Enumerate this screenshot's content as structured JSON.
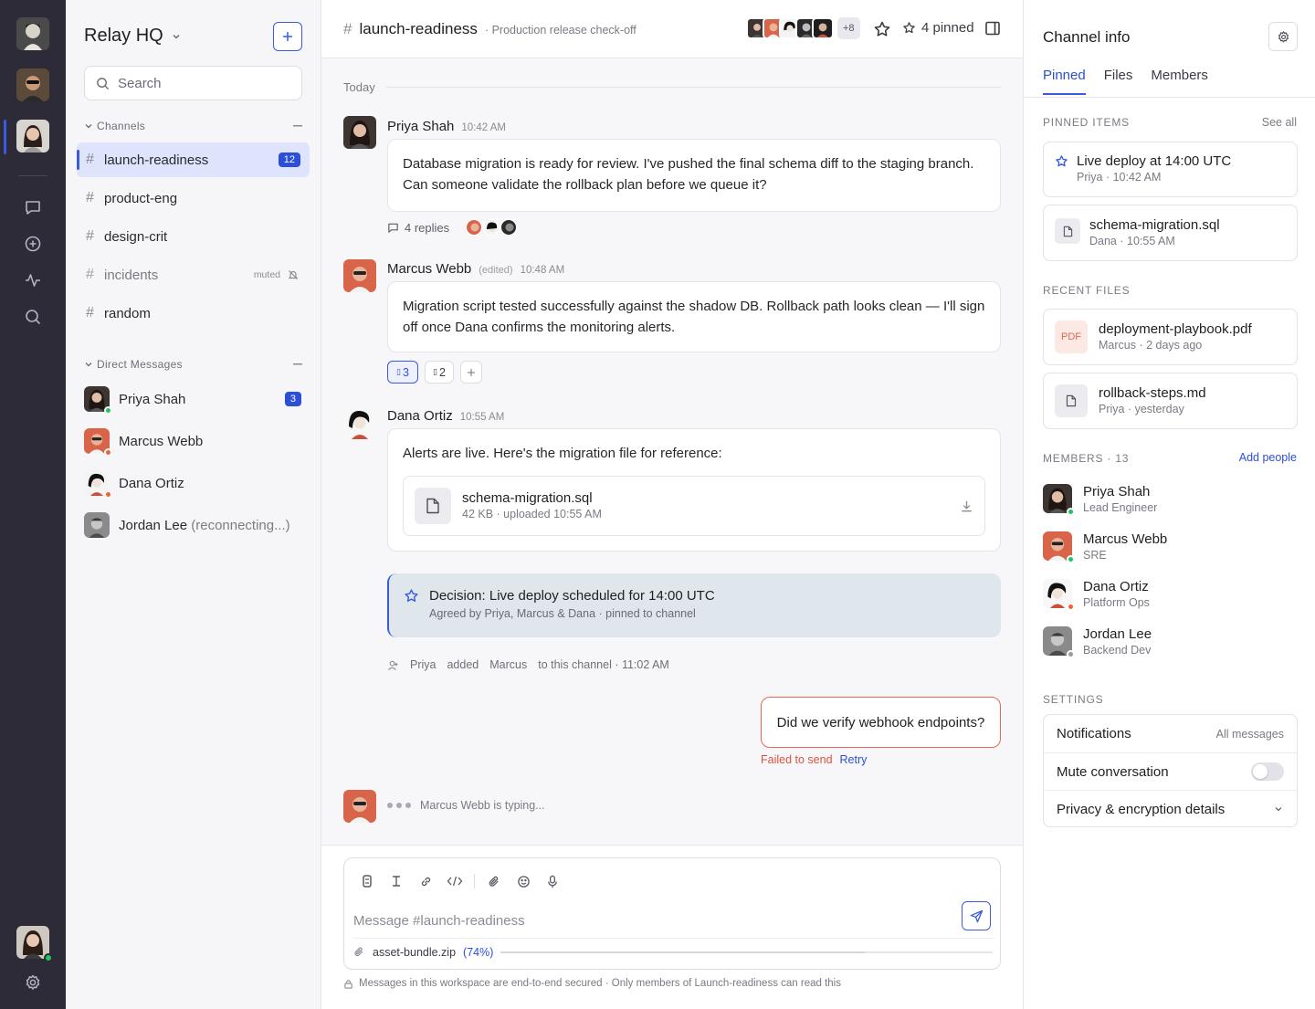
{
  "workspace": {
    "name": "Relay HQ",
    "search_placeholder": "Search"
  },
  "sections": {
    "channels": "Channels",
    "direct_messages": "Direct Messages"
  },
  "channels": [
    {
      "name": "launch-readiness",
      "badge": "12"
    },
    {
      "name": "product-eng"
    },
    {
      "name": "design-crit"
    },
    {
      "name": "incidents",
      "muted_label": "muted"
    },
    {
      "name": "random"
    }
  ],
  "dms": [
    {
      "name": "Priya Shah",
      "badge": "3",
      "status_color": "#22c55e"
    },
    {
      "name": "Marcus Webb",
      "status_color": "#e8673a"
    },
    {
      "name": "Dana Ortiz",
      "status_color": "#e8673a"
    },
    {
      "name": "Jordan Lee",
      "suffix": "(reconnecting...)"
    }
  ],
  "channel": {
    "name": "launch-readiness",
    "topic": "· Production release check-off",
    "member_overflow": "+8",
    "pinned_label": "4 pinned",
    "day": "Today"
  },
  "messages": {
    "priya": {
      "author": "Priya Shah",
      "time": "10:42 AM",
      "text": "Database migration is ready for review. I've pushed the final schema diff to the staging branch. Can someone validate the rollback plan before we queue it?",
      "replies": "4 replies"
    },
    "marcus": {
      "author": "Marcus Webb",
      "edited": "(edited)",
      "time": "10:48 AM",
      "text": "Migration script tested successfully against the shadow DB. Rollback path looks clean — I'll sign off once Dana confirms the monitoring alerts.",
      "reactions": [
        {
          "icon": "thumbs-up-icon",
          "count": "3"
        },
        {
          "icon": "eyes-icon",
          "count": "2"
        }
      ]
    },
    "dana": {
      "author": "Dana Ortiz",
      "time": "10:55 AM",
      "text": "Alerts are live. Here's the migration file for reference:",
      "file_name": "schema-migration.sql",
      "file_meta": "42 KB · uploaded 10:55 AM"
    },
    "decision": {
      "title": "Decision: Live deploy scheduled for 14:00 UTC",
      "subtitle": "Agreed by Priya, Marcus & Dana · pinned to channel"
    },
    "system": {
      "actor": "Priya",
      "verb": "added",
      "target": "Marcus",
      "rest": "to this channel · 11:02 AM"
    },
    "failed": {
      "text": "Did we verify webhook endpoints?",
      "error": "Failed to send",
      "retry": "Retry"
    },
    "typing": "Marcus Webb is typing..."
  },
  "composer": {
    "placeholder": "Message #launch-readiness",
    "upload_name": "asset-bundle.zip",
    "upload_pct": "(74%)",
    "upload_progress": 0.74,
    "secure_note": "Messages in this workspace are end-to-end secured · Only members of Launch-readiness can read this"
  },
  "panel": {
    "title": "Channel info",
    "tabs": [
      "Pinned",
      "Files",
      "Members"
    ],
    "pinned_label": "Pinned items",
    "see_all": "See all",
    "pinned": [
      {
        "title": "Live deploy at 14:00 UTC",
        "meta": "Priya · 10:42 AM"
      },
      {
        "title": "schema-migration.sql",
        "meta": "Dana · 10:55 AM"
      }
    ],
    "recent_files_label": "Recent files",
    "files": [
      {
        "badge": "PDF",
        "title": "deployment-playbook.pdf",
        "meta": "Marcus · 2 days ago"
      },
      {
        "title": "rollback-steps.md",
        "meta": "Priya · yesterday"
      }
    ],
    "members_label": "Members · 13",
    "add_people": "Add people",
    "members": [
      {
        "name": "Priya Shah",
        "role": "Lead Engineer",
        "status_color": "#22c55e"
      },
      {
        "name": "Marcus Webb",
        "role": "SRE",
        "status_color": "#22c55e"
      },
      {
        "name": "Dana Ortiz",
        "role": "Platform Ops",
        "status_color": "#e8673a"
      },
      {
        "name": "Jordan Lee",
        "role": "Backend Dev",
        "status_color": "#9a9aa3"
      }
    ],
    "settings_label": "Settings",
    "settings": {
      "notifications": "Notifications",
      "notifications_value": "All messages",
      "mute": "Mute conversation",
      "privacy": "Privacy & encryption details"
    }
  },
  "colors": {
    "accent": "#3a5be0",
    "rail": "#2e2b38",
    "error": "#e26a55",
    "decision_bg": "#dfe7ec"
  }
}
